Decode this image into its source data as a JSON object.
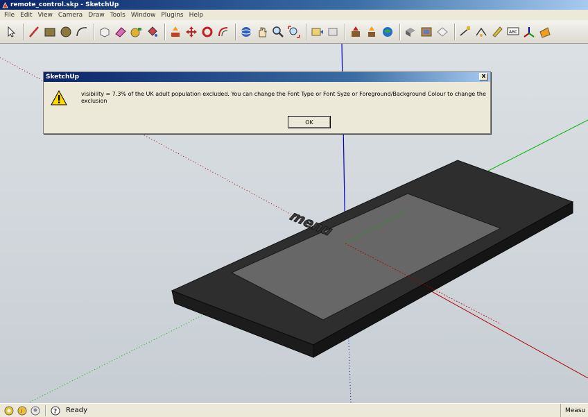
{
  "window": {
    "title": "remote_control.skp - SketchUp"
  },
  "menu": [
    "File",
    "Edit",
    "View",
    "Camera",
    "Draw",
    "Tools",
    "Window",
    "Plugins",
    "Help"
  ],
  "toolbar": {
    "tools": [
      {
        "name": "select-icon"
      },
      {
        "sep": true
      },
      {
        "name": "line-icon"
      },
      {
        "name": "rectangle-icon"
      },
      {
        "name": "circle-icon"
      },
      {
        "name": "arc-icon"
      },
      {
        "sep": true
      },
      {
        "name": "make-component-icon"
      },
      {
        "name": "eraser-icon"
      },
      {
        "name": "tape-measure-icon"
      },
      {
        "name": "paint-bucket-icon"
      },
      {
        "sep": true
      },
      {
        "name": "push-pull-icon"
      },
      {
        "name": "move-icon"
      },
      {
        "name": "rotate-icon"
      },
      {
        "name": "offset-icon"
      },
      {
        "sep": true
      },
      {
        "name": "orbit-icon"
      },
      {
        "name": "pan-icon"
      },
      {
        "name": "zoom-icon"
      },
      {
        "name": "zoom-extents-icon"
      },
      {
        "sep": true
      },
      {
        "name": "previous-view-icon"
      },
      {
        "name": "next-view-icon"
      },
      {
        "sep": true
      },
      {
        "name": "get-models-icon"
      },
      {
        "name": "share-model-icon"
      },
      {
        "name": "google-earth-icon"
      },
      {
        "sep": true
      },
      {
        "name": "components-icon"
      },
      {
        "name": "materials-icon"
      },
      {
        "name": "styles-icon"
      },
      {
        "sep": true
      },
      {
        "name": "dimension-icon"
      },
      {
        "name": "protractor-icon"
      },
      {
        "name": "text-icon"
      },
      {
        "name": "3d-text-icon"
      },
      {
        "name": "axes-icon"
      },
      {
        "name": "section-plane-icon"
      }
    ]
  },
  "dialog": {
    "title": "SketchUp",
    "close": "x",
    "message": "visibility = 7.3% of the UK adult population excluded. You can change the Font Type or Font Syze or Foreground/Background Colour to change the exclusion",
    "ok_label": "OK"
  },
  "model": {
    "label": "menu"
  },
  "status": {
    "text": "Ready",
    "measurements": "Measu"
  },
  "colors": {
    "title_start": "#0a246a",
    "title_end": "#a6caf0",
    "axis_red": "#b00000",
    "axis_green": "#00b000",
    "axis_blue": "#0000c0",
    "body": "#2d2d2d",
    "screen": "#666666"
  }
}
